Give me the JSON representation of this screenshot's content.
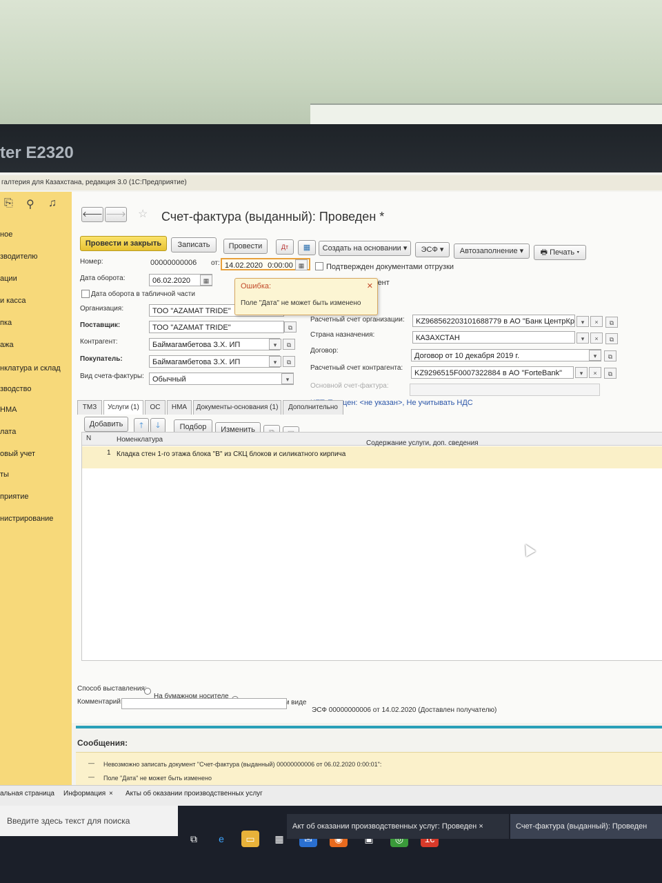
{
  "monitor": {
    "brand": "ter E2320"
  },
  "app": {
    "title": "галтерия для Казахстана, редакция 3.0  (1С:Предприятие)"
  },
  "sidebar": {
    "items": [
      {
        "label": "ное"
      },
      {
        "label": "зводителю"
      },
      {
        "label": "ации"
      },
      {
        "label": "и касса"
      },
      {
        "label": "пка"
      },
      {
        "label": "ажа"
      },
      {
        "label": "нклатура и склад"
      },
      {
        "label": "зводство"
      },
      {
        "label": " НМА"
      },
      {
        "label": "лата"
      },
      {
        "label": "овый учет"
      },
      {
        "label": "ты"
      },
      {
        "label": "приятие"
      },
      {
        "label": "нистрирование"
      }
    ]
  },
  "document": {
    "title": "Счет-фактура (выданный): Проведен *",
    "toolbar": {
      "post_close": "Провести и закрыть",
      "save": "Записать",
      "post": "Провести",
      "create_based": "Создать на основании",
      "esf": "ЭСФ",
      "autofill": "Автозаполнение",
      "print": "Печать"
    },
    "fields": {
      "number_label": "Номер:",
      "number_value": "00000000006",
      "from_label": "от:",
      "date_value": "14.02.2020",
      "time_value": "0:00:00",
      "confirmed_label": "Подтвержден документами отгрузки",
      "turnover_date_label": "Дата оборота:",
      "turnover_date_value": "06.02.2020",
      "turnover_in_table_label": "Дата оборота в табличной части",
      "hidden_right_label": "мент",
      "organization_label": "Организация:",
      "organization_value": "ТОО \"AZAMAT TRIDE\"",
      "supplier_label": "Поставщик:",
      "supplier_value": "ТОО \"AZAMAT TRIDE\"",
      "counterparty_label": "Контрагент:",
      "counterparty_value": "Баймагамбетова З.Х. ИП",
      "buyer_label": "Покупатель:",
      "buyer_value": "Баймагамбетова З.Х. ИП",
      "invoice_type_label": "Вид счета-фактуры:",
      "invoice_type_value": "Обычный",
      "org_account_label": "Расчетный счет организации:",
      "org_account_value": "KZ968562203101688779 в АО \"Банк ЦентрКр",
      "country_label": "Страна назначения:",
      "country_value": "КАЗАХСТАН",
      "contract_label": "Договор:",
      "contract_value": "Договор от 10 декабря 2019 г.",
      "cp_account_label": "Расчетный счет контрагента:",
      "cp_account_value": "KZ9296515F0007322884 в АО \"ForteBank\"",
      "base_invoice_label": "Основной счет-фактура:",
      "price_link": "KZT, Тип цен: <не указан>, Не учитывать НДС"
    },
    "error_tooltip": {
      "title": "Ошибка:",
      "message": "Поле \"Дата\" не может быть изменено"
    },
    "tabs": [
      "ТМЗ",
      "Услуги (1)",
      "ОС",
      "НМА",
      "Документы-основания (1)",
      "Дополнительно"
    ],
    "table_toolbar": {
      "add": "Добавить",
      "pick": "Подбор",
      "change": "Изменить"
    },
    "table": {
      "columns": [
        "N",
        "Номенклатура",
        "Содержание услуги, доп. сведения"
      ],
      "rows": [
        {
          "n": "1",
          "item": "Кладка стен 1-го этажа блока \"В\" из СКЦ блоков и силикатного кирпича",
          "content": ""
        }
      ]
    },
    "issue_method": {
      "label": "Способ выставления:",
      "paper": "На бумажном носителе",
      "electronic": "В электронном виде",
      "selected": "electronic",
      "esf_status": "ЭСФ 00000000006 от 14.02.2020 (Доставлен получателю)"
    },
    "comment_label": "Комментарий:"
  },
  "messages": {
    "header": "Сообщения:",
    "items": [
      "Невозможно записать документ \"Счет-фактура (выданный) 00000000006 от 06.02.2020 0:00:01\":",
      "Поле \"Дата\" не может быть изменено"
    ]
  },
  "open_tabs": [
    "альная страница",
    "Информация",
    "Акты об оказании производственных услуг",
    "Акт об оказании производственных услуг: Проведен",
    "Счет-фактура (выданный): Проведен"
  ],
  "taskbar": {
    "search_placeholder": "Введите здесь текст для поиска"
  }
}
